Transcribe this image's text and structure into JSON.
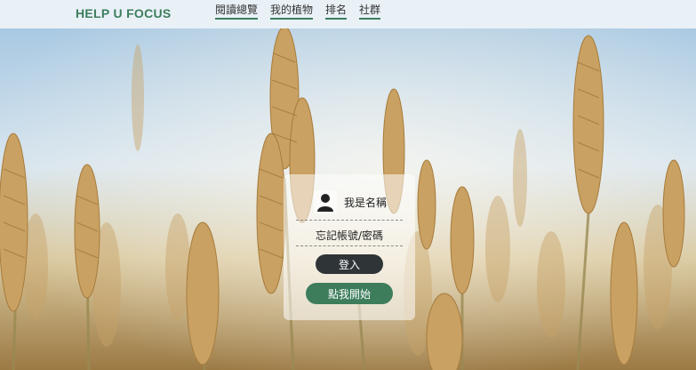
{
  "header": {
    "brand": "HELP U FOCUS",
    "nav": [
      {
        "label": "閱讀總覽"
      },
      {
        "label": "我的植物"
      },
      {
        "label": "排名"
      },
      {
        "label": "社群"
      }
    ]
  },
  "login_card": {
    "username": "我是名稱",
    "forgot_label": "忘記帳號/密碼",
    "login_button": "登入",
    "start_button": "點我開始"
  },
  "colors": {
    "accent": "#3d7d5c",
    "dark_button": "#2f3437",
    "header_bg": "#e9f1f7"
  },
  "background": {
    "icon": "wheat-field-image"
  }
}
